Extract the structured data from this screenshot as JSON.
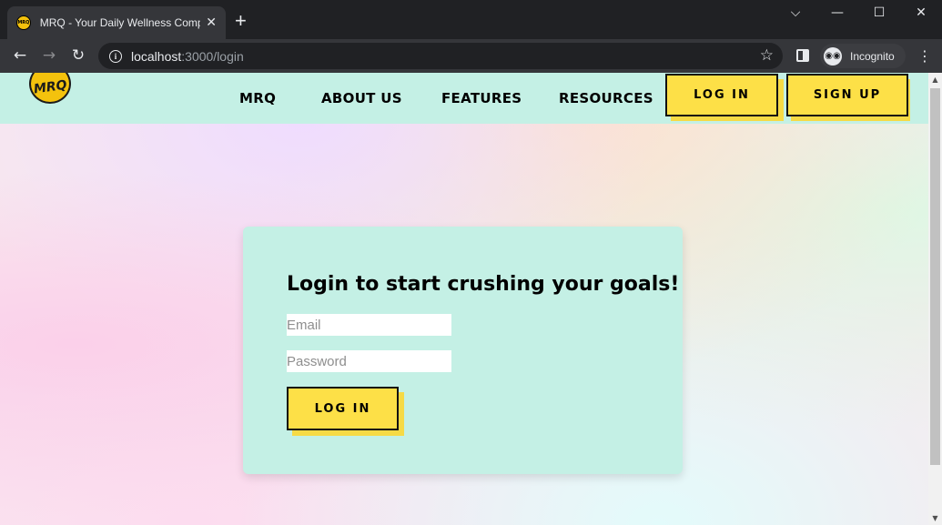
{
  "browser": {
    "tab": {
      "title": "MRQ - Your Daily Wellness Companion",
      "favicon": "MRQ"
    },
    "new_tab": "+",
    "window_controls": {
      "tabsearch": "⌵",
      "minimize": "—",
      "maximize": "☐",
      "close": "✕"
    },
    "url_host": "localhost",
    "url_path": ":3000/login",
    "incognito_label": "Incognito"
  },
  "site": {
    "logo_text": "MRQ",
    "nav": {
      "mrq": "MRQ",
      "about": "ABOUT US",
      "features": "FEATURES",
      "resources": "RESOURCES"
    },
    "header_login": "LOG IN",
    "header_signup": "SIGN UP"
  },
  "login": {
    "title": "Login to start crushing your goals!",
    "email_placeholder": "Email",
    "password_placeholder": "Password",
    "submit": "LOG IN"
  },
  "colors": {
    "mint": "#c4f0e5",
    "yellow": "#fde047",
    "chrome_dark": "#202124",
    "chrome_mid": "#35363a"
  }
}
